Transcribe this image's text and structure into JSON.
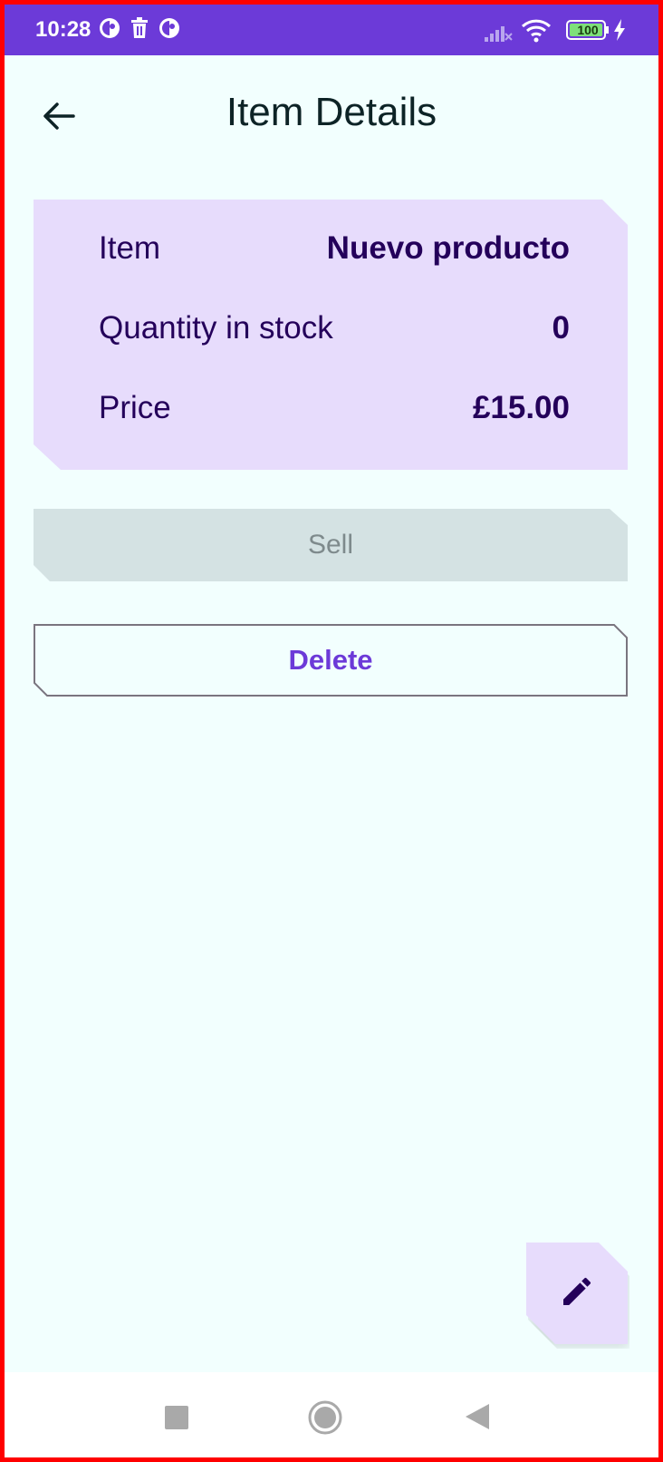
{
  "status_bar": {
    "time": "10:28",
    "battery": "100",
    "icons": [
      "app-notification-icon",
      "trash-icon",
      "app-notification-icon",
      "signal-off-icon",
      "wifi-icon",
      "battery-icon",
      "charging-icon"
    ]
  },
  "app_bar": {
    "title": "Item Details",
    "back_icon": "arrow-back-icon"
  },
  "details": {
    "rows": [
      {
        "label": "Item",
        "value": "Nuevo producto"
      },
      {
        "label": "Quantity in stock",
        "value": "0"
      },
      {
        "label": "Price",
        "value": "£15.00"
      }
    ]
  },
  "actions": {
    "sell_label": "Sell",
    "sell_enabled": false,
    "delete_label": "Delete"
  },
  "fab": {
    "icon": "edit-pencil-icon"
  },
  "nav_bar": {
    "buttons": [
      "recents-square-icon",
      "home-circle-icon",
      "back-triangle-icon"
    ]
  },
  "colors": {
    "status_bar": "#6c3ad8",
    "background": "#f2fffe",
    "card": "#e7dcfc",
    "primary_text": "#24005a",
    "accent": "#6c3ad8",
    "disabled_button": "#d4e2e3"
  }
}
